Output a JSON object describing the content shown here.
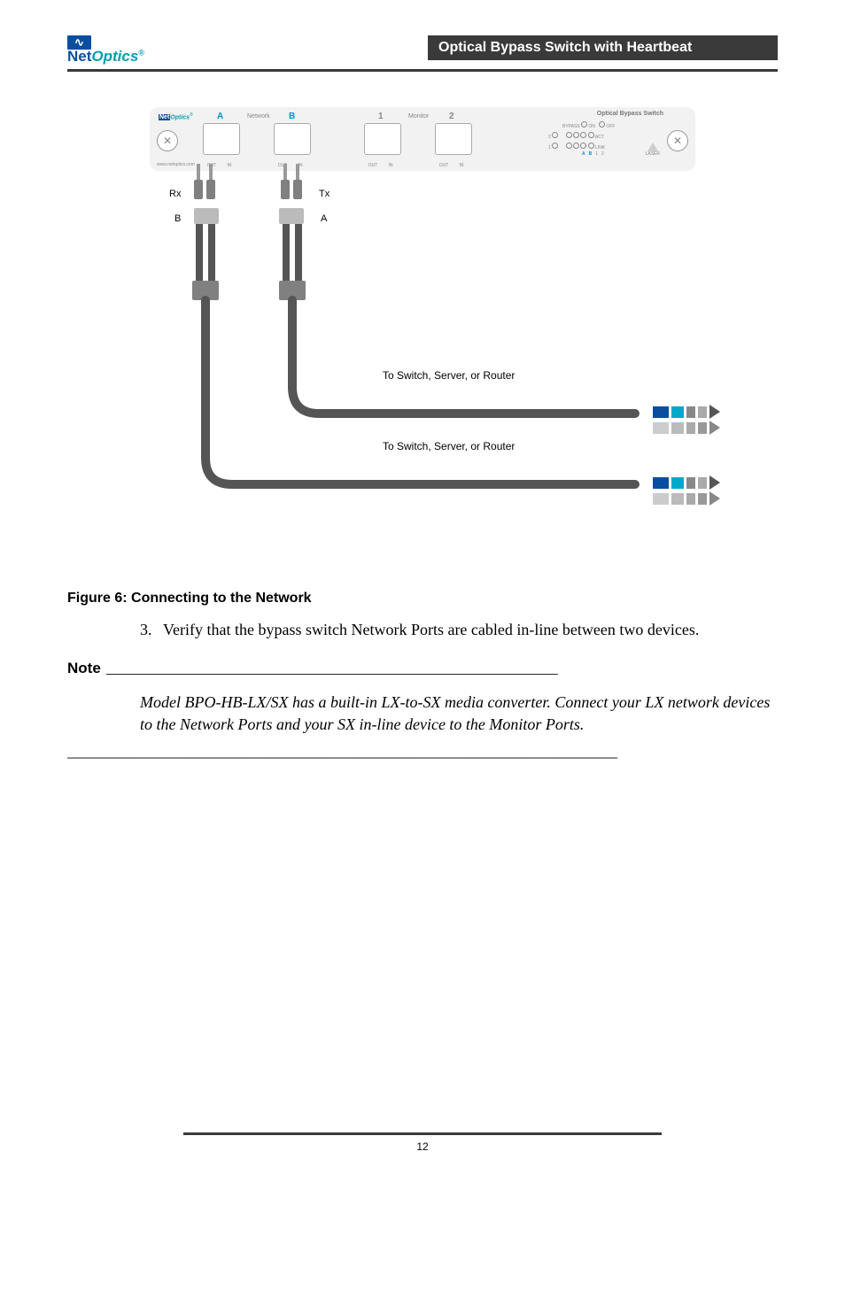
{
  "header": {
    "logo_net": "Net",
    "logo_optics": "Optics",
    "logo_reg": "®",
    "bar": "Optical Bypass Switch with Heartbeat"
  },
  "panel": {
    "logo_net": "Net",
    "logo_optics": "Optics",
    "logo_reg": "®",
    "url": "www.netoptics.com",
    "network_label": "Network",
    "monitor_label": "Monitor",
    "A": "A",
    "B": "B",
    "one": "1",
    "two": "2",
    "out": "OUT",
    "in": "IN",
    "status_title": "Optical Bypass Switch",
    "bypass": "BYPASS",
    "on": "ON",
    "off": "OFF",
    "act": "ACT",
    "link": "LINK",
    "status_2": "2",
    "status_1": "1",
    "status_A": "A",
    "status_B": "B",
    "laser": "LASER"
  },
  "diagram": {
    "rx": "Rx",
    "tx": "Tx",
    "cb_b": "B",
    "cb_a": "A",
    "dest1": "To Switch, Server, or Router",
    "dest2": "To Switch, Server, or Router"
  },
  "caption_bold": "Figure 6:",
  "caption_rest": " Connecting to the Network",
  "list_num": "3.",
  "list_text": "Verify that the bypass switch Network Ports are cabled in-line between two devices.",
  "note_label": "Note",
  "note_body": "Model BPO-HB-LX/SX has a built-in LX-to-SX media converter. Connect your LX network devices to the Network Ports and your SX in-line device to the Monitor Ports.",
  "note_fill": " ____________________________________________________________",
  "long_rule": "_____________________________________________________________________",
  "page_number": "12"
}
